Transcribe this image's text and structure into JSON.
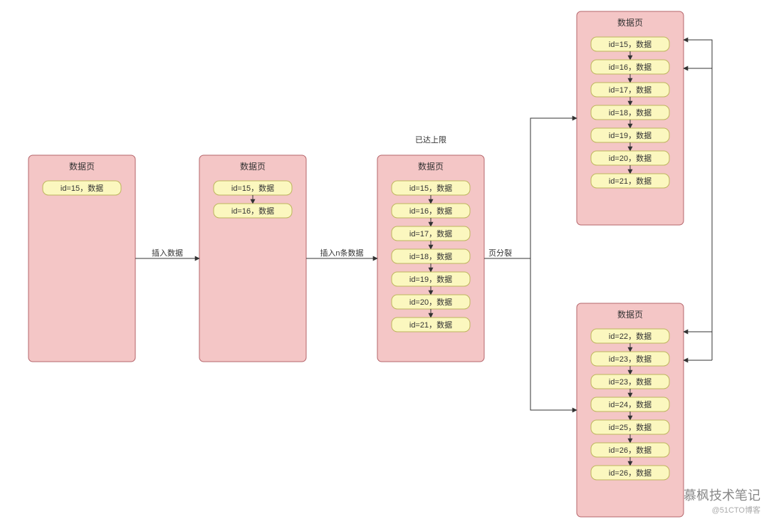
{
  "pages": [
    {
      "title": "数据页",
      "rows": [
        "id=15，数据"
      ]
    },
    {
      "title": "数据页",
      "rows": [
        "id=15，数据",
        "id=16，数据"
      ]
    },
    {
      "title": "数据页",
      "rows": [
        "id=15，数据",
        "id=16，数据",
        "id=17，数据",
        "id=18，数据",
        "id=19，数据",
        "id=20，数据",
        "id=21，数据"
      ]
    },
    {
      "title": "数据页",
      "rows": [
        "id=15，数据",
        "id=16，数据",
        "id=17，数据",
        "id=18，数据",
        "id=19，数据",
        "id=20，数据",
        "id=21，数据"
      ]
    },
    {
      "title": "数据页",
      "rows": [
        "id=22，数据",
        "id=23，数据",
        "id=23，数据",
        "id=24，数据",
        "id=25，数据",
        "id=26，数据",
        "id=26，数据"
      ]
    }
  ],
  "labels": {
    "insert1": "插入数据",
    "insert2": "插入n条数据",
    "split": "页分裂",
    "limit": "已达上限"
  },
  "watermark": {
    "main": "慕枫技术笔记",
    "sub": "@51CTO博客"
  }
}
